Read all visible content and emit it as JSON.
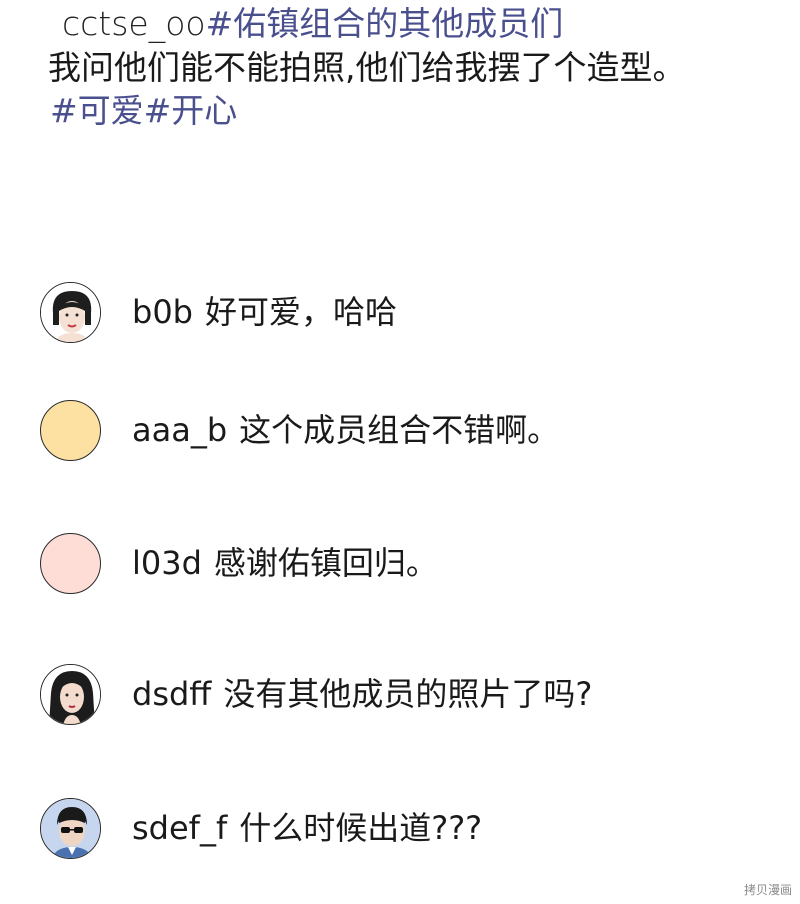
{
  "post": {
    "username": "cctse_oo",
    "tag_main": "#佑镇组合的其他成员们",
    "body": "我问他们能不能拍照,他们给我摆了个造型。",
    "tags": "#可爱#开心"
  },
  "comments": [
    {
      "user": "b0b",
      "text": "好可爱，哈哈",
      "avatar": "woman-short-hair-avatar"
    },
    {
      "user": "aaa_b",
      "text": "这个成员组合不错啊。",
      "avatar": "orange-blank-avatar",
      "color": "#fde1a3"
    },
    {
      "user": "l03d",
      "text": "感谢佑镇回归。",
      "avatar": "pink-blank-avatar",
      "color": "#fdddd6"
    },
    {
      "user": "dsdff",
      "text": "没有其他成员的照片了吗?",
      "avatar": "woman-long-hair-avatar"
    },
    {
      "user": "sdef_f",
      "text": "什么时候出道???",
      "avatar": "man-sunglasses-avatar"
    }
  ],
  "watermark": "拷贝漫画"
}
